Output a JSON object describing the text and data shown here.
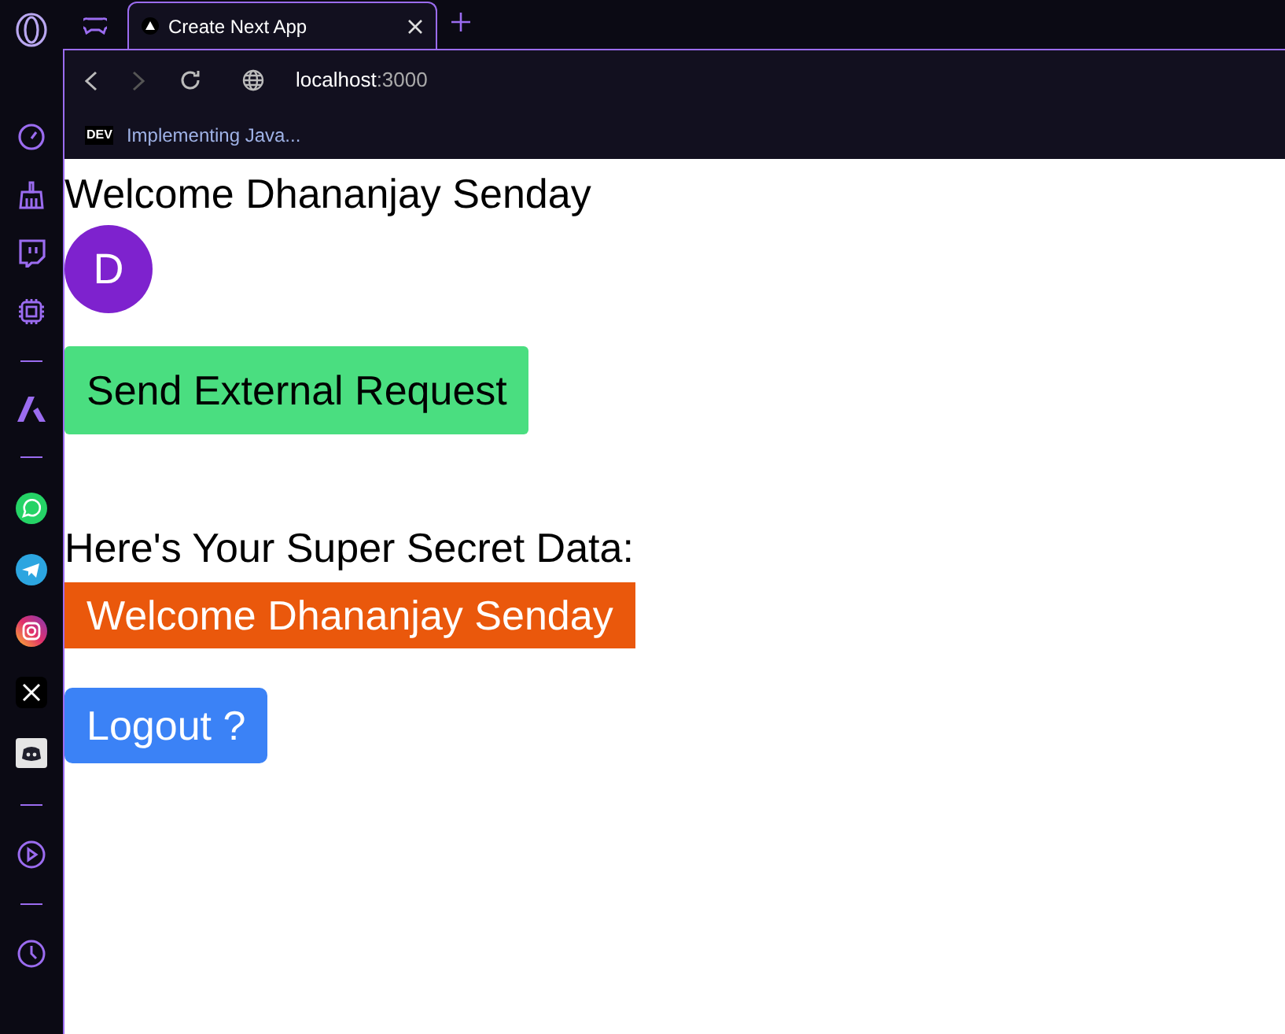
{
  "tab": {
    "title": "Create Next App",
    "selected": true
  },
  "address": {
    "host": "localhost",
    "port": ":3000"
  },
  "bookmarks": [
    {
      "badge": "DEV",
      "label": "Implementing Java..."
    }
  ],
  "sidebar": {
    "items": [
      {
        "kind": "gauge"
      },
      {
        "kind": "broom"
      },
      {
        "kind": "twitch"
      },
      {
        "kind": "chip"
      },
      {
        "kind": "divider"
      },
      {
        "kind": "aria"
      },
      {
        "kind": "divider"
      },
      {
        "kind": "whatsapp"
      },
      {
        "kind": "telegram"
      },
      {
        "kind": "instagram"
      },
      {
        "kind": "x"
      },
      {
        "kind": "discord"
      },
      {
        "kind": "divider"
      },
      {
        "kind": "play"
      },
      {
        "kind": "divider"
      },
      {
        "kind": "clock"
      }
    ]
  },
  "page": {
    "heading": "Welcome Dhananjay Senday",
    "avatar": "D",
    "request_button": "Send External Request",
    "secret_label": "Here's Your Super Secret Data:",
    "secret_value": "Welcome Dhananjay Senday",
    "logout_button": "Logout ?"
  }
}
